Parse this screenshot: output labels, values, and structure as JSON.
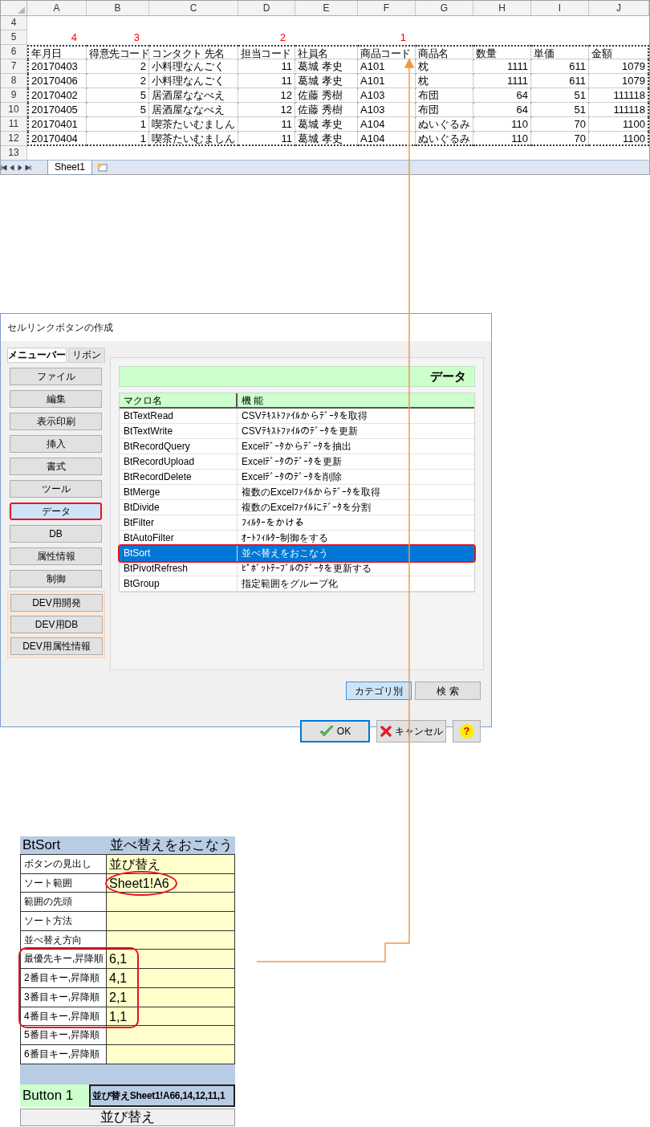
{
  "spreadsheet": {
    "columns": [
      "A",
      "B",
      "C",
      "D",
      "E",
      "F",
      "G",
      "H",
      "I",
      "J"
    ],
    "row_numbers": [
      "4",
      "5",
      "6",
      "7",
      "8",
      "9",
      "10",
      "11",
      "12",
      "13"
    ],
    "header": [
      {
        "label": "年月日",
        "kind": "text",
        "sort_mark": "4"
      },
      {
        "label": "得意先コード",
        "kind": "number",
        "sort_mark": "3"
      },
      {
        "label": "コンタクト 先名",
        "kind": "text"
      },
      {
        "label": "担当コード",
        "kind": "number",
        "sort_mark": "2"
      },
      {
        "label": "社員名",
        "kind": "text"
      },
      {
        "label": "商品コード",
        "kind": "text",
        "sort_mark": "1"
      },
      {
        "label": "商品名",
        "kind": "text"
      },
      {
        "label": "数量",
        "kind": "number"
      },
      {
        "label": "単価",
        "kind": "number"
      },
      {
        "label": "金額",
        "kind": "number"
      }
    ],
    "rows": [
      [
        "20170403",
        "2",
        "小料理なんごく",
        "11",
        "葛城 孝史",
        "A101",
        "枕",
        "1111",
        "611",
        "1079"
      ],
      [
        "20170406",
        "2",
        "小料理なんごく",
        "11",
        "葛城 孝史",
        "A101",
        "枕",
        "1111",
        "611",
        "1079"
      ],
      [
        "20170402",
        "5",
        "居酒屋ななべえ",
        "12",
        "佐藤 秀樹",
        "A103",
        "布団",
        "64",
        "51",
        "111118"
      ],
      [
        "20170405",
        "5",
        "居酒屋ななべえ",
        "12",
        "佐藤 秀樹",
        "A103",
        "布団",
        "64",
        "51",
        "111118"
      ],
      [
        "20170401",
        "1",
        "喫茶たいむましん",
        "11",
        "葛城 孝史",
        "A104",
        "ぬいぐるみ",
        "110",
        "70",
        "1100"
      ],
      [
        "20170404",
        "1",
        "喫茶たいむましん",
        "11",
        "葛城 孝史",
        "A104",
        "ぬいぐるみ",
        "110",
        "70",
        "1100"
      ]
    ],
    "sheet_tabs": [
      {
        "label": "Sheet1",
        "selected": true
      }
    ]
  },
  "dialog": {
    "title": "セルリンクボタンの作成",
    "mode_tabs": [
      {
        "label": "メニューバー",
        "selected": true
      },
      {
        "label": "リボン",
        "selected": false
      }
    ],
    "categories": [
      {
        "label": "ファイル",
        "kind": "standard",
        "selected": false
      },
      {
        "label": "編集",
        "kind": "standard",
        "selected": false
      },
      {
        "label": "表示印刷",
        "kind": "standard",
        "selected": false
      },
      {
        "label": "挿入",
        "kind": "standard",
        "selected": false
      },
      {
        "label": "書式",
        "kind": "standard",
        "selected": false
      },
      {
        "label": "ツール",
        "kind": "standard",
        "selected": false
      },
      {
        "label": "データ",
        "kind": "standard",
        "selected": true
      },
      {
        "label": "DB",
        "kind": "standard",
        "selected": false
      },
      {
        "label": "属性情報",
        "kind": "standard",
        "selected": false
      },
      {
        "label": "制御",
        "kind": "standard",
        "selected": false
      },
      {
        "label": "DEV用開発",
        "kind": "dev",
        "selected": false
      },
      {
        "label": "DEV用DB",
        "kind": "dev",
        "selected": false
      },
      {
        "label": "DEV用属性情報",
        "kind": "dev",
        "selected": false
      }
    ],
    "panel_title": "データ",
    "columns": [
      "マクロ名",
      "機 能"
    ],
    "macros": [
      {
        "name": "BtTextRead",
        "function": "CSVﾃｷｽﾄﾌｧｲﾙからﾃﾞｰﾀを取得",
        "selected": false
      },
      {
        "name": "BtTextWrite",
        "function": "CSVﾃｷｽﾄﾌｧｲﾙのﾃﾞｰﾀを更新",
        "selected": false
      },
      {
        "name": "BtRecordQuery",
        "function": "Excelﾃﾞｰﾀからﾃﾞｰﾀを抽出",
        "selected": false
      },
      {
        "name": "BtRecordUpload",
        "function": "Excelﾃﾞｰﾀのﾃﾞｰﾀを更新",
        "selected": false
      },
      {
        "name": "BtRecordDelete",
        "function": "Excelﾃﾞｰﾀのﾃﾞｰﾀを削除",
        "selected": false
      },
      {
        "name": "BtMerge",
        "function": "複数のExcelﾌｧｲﾙからﾃﾞｰﾀを取得",
        "selected": false
      },
      {
        "name": "BtDivide",
        "function": "複数のExcelﾌｧｲﾙにﾃﾞｰﾀを分割",
        "selected": false
      },
      {
        "name": "BtFilter",
        "function": "ﾌｨﾙﾀｰをかける",
        "selected": false
      },
      {
        "name": "BtAutoFilter",
        "function": "ｵｰﾄﾌｨﾙﾀｰ制御をする",
        "selected": false
      },
      {
        "name": "BtSort",
        "function": "並べ替えをおこなう",
        "selected": true
      },
      {
        "name": "BtPivotRefresh",
        "function": "ﾋﾟﾎﾞｯﾄﾃｰﾌﾞﾙのﾃﾞｰﾀを更新する",
        "selected": false
      },
      {
        "name": "BtGroup",
        "function": "指定範囲をグループ化",
        "selected": false
      }
    ],
    "view_tabs": [
      {
        "label": "カテゴリ別",
        "selected": true
      },
      {
        "label": "検 索",
        "selected": false
      }
    ],
    "buttons": [
      {
        "label": "OK",
        "kind": "ok"
      },
      {
        "label": "キャンセル",
        "kind": "cancel"
      },
      {
        "label": "?",
        "kind": "help"
      }
    ]
  },
  "settings": {
    "macro": "BtSort",
    "description": "並べ替えをおこなう",
    "rows": [
      {
        "label": "ボタンの見出し",
        "value": "並び替え",
        "circled": false,
        "grouped": false
      },
      {
        "label": "ソート範囲",
        "value": "Sheet1!A6",
        "circled": true,
        "grouped": false
      },
      {
        "label": "範囲の先頭",
        "circled": false,
        "grouped": false
      },
      {
        "label": "ソート方法",
        "circled": false,
        "grouped": false
      },
      {
        "label": "並べ替え方向",
        "circled": false,
        "grouped": false
      },
      {
        "label": "最優先キー,昇降順",
        "value": "6,1",
        "circled": false,
        "grouped": true
      },
      {
        "label": "2番目キー,昇降順",
        "value": "4,1",
        "circled": false,
        "grouped": true
      },
      {
        "label": "3番目キー,昇降順",
        "value": "2,1",
        "circled": false,
        "grouped": true
      },
      {
        "label": "4番目キー,昇降順",
        "value": "1,1",
        "circled": false,
        "grouped": true
      },
      {
        "label": "5番目キー,昇降順",
        "circled": false,
        "grouped": false
      },
      {
        "label": "6番目キー,昇降順",
        "circled": false,
        "grouped": false
      }
    ],
    "button_name": "Button 1",
    "button_formula": "並び替えSheet1!A66,14,12,11,1",
    "button_caption": "並び替え"
  }
}
